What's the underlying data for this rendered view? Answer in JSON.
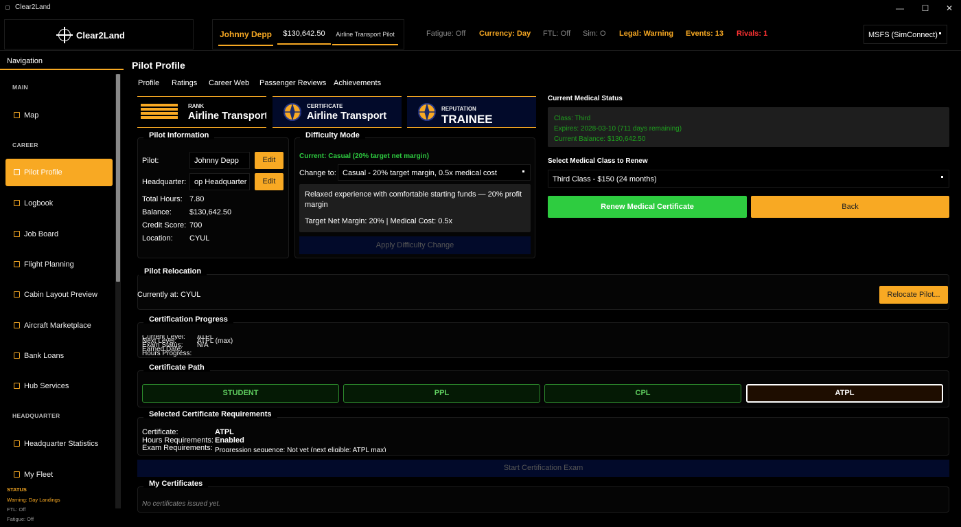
{
  "window": {
    "title": "Clear2Land",
    "controls": [
      "—",
      "☐",
      "✕"
    ]
  },
  "topbar": {
    "logo_text": "Clear2Land",
    "pilot_name": "Johnny Depp",
    "balance": "$130,642.50",
    "rank": "Airline Transport Pilot",
    "fatigue": "Fatigue: Off",
    "currency": "Currency: Day",
    "ftl": "FTL: Off",
    "sim": "Sim: O",
    "legal": "Legal: Warning",
    "events": "Events: 13",
    "rivals": "Rivals: 1",
    "sim_select": "MSFS (SimConnect)"
  },
  "sidebar": {
    "header": "Navigation",
    "sections": {
      "main": "MAIN",
      "career": "CAREER",
      "hq": "HEADQUARTER"
    },
    "items": {
      "map": "Map",
      "pilot_profile": "Pilot Profile",
      "logbook": "Logbook",
      "job_board": "Job Board",
      "flight_planning": "Flight Planning",
      "cabin_layout": "Cabin Layout Preview",
      "aircraft_marketplace": "Aircraft Marketplace",
      "bank_loans": "Bank Loans",
      "hub_services": "Hub Services",
      "hq_stats": "Headquarter Statistics",
      "my_fleet": "My Fleet"
    },
    "status": {
      "title": "STATUS",
      "warning": "Warning: Day Landings",
      "ftl": "FTL: Off",
      "fatigue": "Fatigue: Off"
    }
  },
  "page": {
    "title": "Pilot Profile",
    "tabs": [
      "Profile",
      "Ratings",
      "Career Web",
      "Passenger Reviews",
      "Achievements"
    ]
  },
  "cards": {
    "rank_label": "RANK",
    "rank_value": "Airline Transport Pilot",
    "cert_label": "CERTIFICATE",
    "cert_value": "Airline Transport",
    "rep_label": "REPUTATION",
    "rep_value": "TRAINEE"
  },
  "pilot_info": {
    "title": "Pilot Information",
    "pilot_label": "Pilot:",
    "pilot_value": "Johnny Depp",
    "hq_label": "Headquarter:",
    "hq_value": "op Headquarter",
    "edit": "Edit",
    "hours_label": "Total Hours:",
    "hours_value": "7.80",
    "balance_label": "Balance:",
    "balance_value": "$130,642.50",
    "credit_label": "Credit Score:",
    "credit_value": "700",
    "location_label": "Location:",
    "location_value": "CYUL"
  },
  "difficulty": {
    "title": "Difficulty Mode",
    "current": "Current: Casual (20% target net margin)",
    "change_label": "Change to:",
    "change_value": "Casual - 20% target margin, 0.5x medical cost",
    "desc": "Relaxed experience with comfortable starting funds — 20% profit margin",
    "detail": "Target Net Margin: 20%  |  Medical Cost: 0.5x",
    "apply": "Apply Difficulty Change"
  },
  "medical": {
    "status_title": "Current Medical Status",
    "class_line": "Class: Third",
    "expires_line": "Expires: 2028-03-10 (711 days remaining)",
    "balance_line": "Current Balance: $130,642.50",
    "select_title": "Select Medical Class to Renew",
    "select_value": "Third Class - $150 (24 months)",
    "renew": "Renew Medical Certificate",
    "back": "Back"
  },
  "relocation": {
    "title": "Pilot Relocation",
    "current": "Currently at: CYUL",
    "button": "Relocate Pilot..."
  },
  "cert_progress": {
    "title": "Certification Progress",
    "lines": [
      "Current Level:",
      "Next Level:",
      "Exam Status:",
      "Earned Date:",
      "Hours Progress:"
    ],
    "values": [
      "ATPL",
      "ATPL (max)",
      "",
      "",
      "N/A"
    ]
  },
  "cert_path": {
    "title": "Certificate Path",
    "student": "STUDENT",
    "ppl": "PPL",
    "cpl": "CPL",
    "atpl": "ATPL"
  },
  "requirements": {
    "title": "Selected Certificate Requirements",
    "cert_label": "Certificate:",
    "cert_value": "ATPL",
    "hours_label": "Hours Requirements:",
    "hours_value": "Enabled",
    "exam_label": "Exam Requirements:",
    "exam_value": "Progression sequence: Not yet (next eligible: ATPL max)",
    "start_exam": "Start Certification Exam"
  },
  "my_certs": {
    "title": "My Certificates",
    "empty": "No certificates issued yet."
  },
  "colors": {
    "accent": "#f8a923",
    "green": "#2ecc40",
    "red": "#ff3333",
    "navy": "#020a2a"
  }
}
